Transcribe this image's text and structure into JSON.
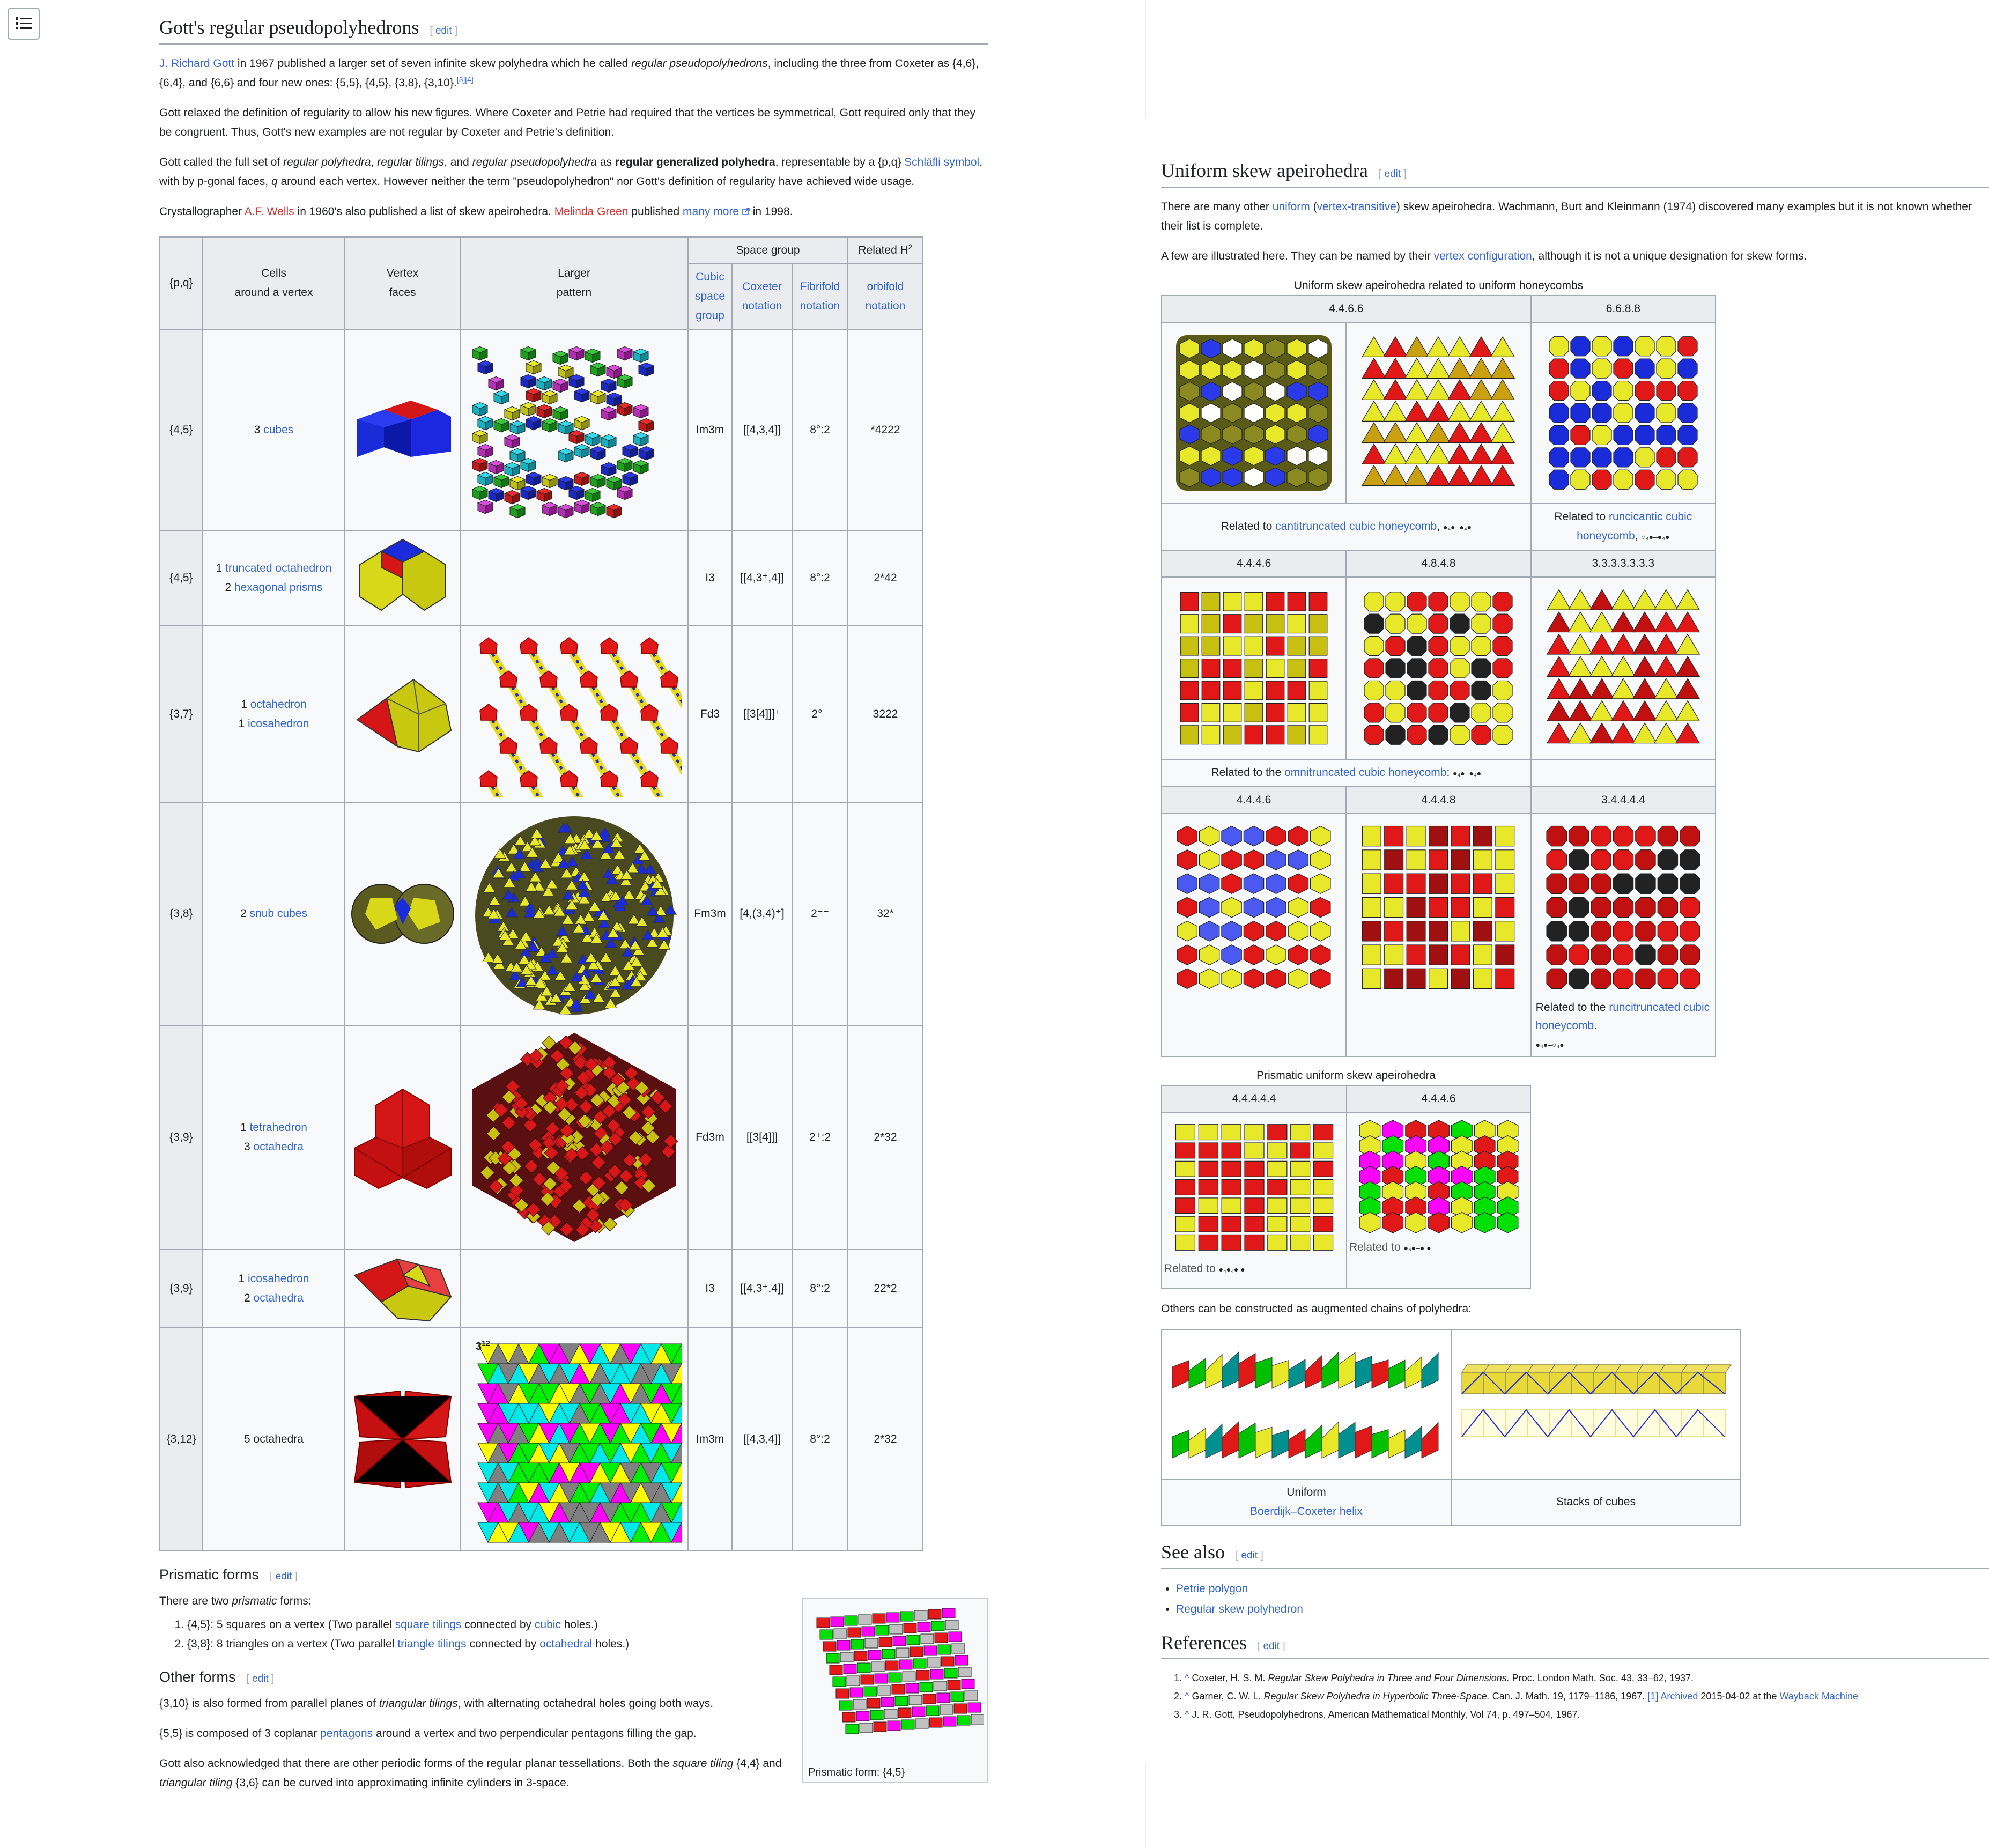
{
  "menu_icon": "list-icon",
  "gott": {
    "title": "Gott's regular pseudopolyhedrons",
    "edit": "edit",
    "p1": {
      "a1": "J. Richard Gott",
      "t1": " in 1967 published a larger set of seven infinite skew polyhedra which he called ",
      "em1": "regular pseudopolyhedrons",
      "t2": ", including the three from Coxeter as {4,6}, {6,4}, and {6,6} and four new ones: {5,5}, {4,5}, {3,8}, {3,10}.",
      "sup": "[3][4]"
    },
    "p2": "Gott relaxed the definition of regularity to allow his new figures. Where Coxeter and Petrie had required that the vertices be symmetrical, Gott required only that they be congruent. Thus, Gott's new examples are not regular by Coxeter and Petrie's definition.",
    "p3": {
      "t1": "Gott called the full set of ",
      "em1": "regular polyhedra",
      "t2": ", ",
      "em2": "regular tilings",
      "t3": ", and ",
      "em3": "regular pseudopolyhedra",
      "t4": " as ",
      "b1": "regular generalized polyhedra",
      "t5": ", representable by a {p,q} ",
      "a1": "Schläfli symbol",
      "t6": ", with by p-gonal faces, ",
      "em4": "q",
      "t7": " around each vertex. However neither the term \"pseudopolyhedron\" nor Gott's definition of regularity have achieved wide usage."
    },
    "p4": {
      "t1": "Crystallographer ",
      "a1": "A.F. Wells",
      "t2": " in 1960's also published a list of skew apeirohedra. ",
      "a2": "Melinda Green",
      "t3": " published ",
      "a3": "many more",
      "t4": " in 1998."
    }
  },
  "table": {
    "h_pq": "{p,q}",
    "h_cells1": "Cells",
    "h_cells2": "around a vertex",
    "h_vf1": "Vertex",
    "h_vf2": "faces",
    "h_lp1": "Larger",
    "h_lp2": "pattern",
    "h_space": "Space group",
    "h_rel": "Related H",
    "h_rel_sup": "2",
    "h_cubic": "Cubic space group",
    "h_cox": "Coxeter notation",
    "h_fib": "Fibrifold notation",
    "h_orb": "orbifold notation",
    "rows": [
      {
        "pq": "{4,5}",
        "c1n": "3 ",
        "c1l": "cubes",
        "c2n": "",
        "c2l": "",
        "sg": "Im3m",
        "cox": "[[4,3,4]]",
        "fib": "8°:2",
        "orb": "*4222"
      },
      {
        "pq": "{4,5}",
        "c1n": "1 ",
        "c1l": "truncated octahedron",
        "c2n": "2 ",
        "c2l": "hexagonal prisms",
        "sg": "I3",
        "cox": "[[4,3⁺,4]]",
        "fib": "8°:2",
        "orb": "2*42"
      },
      {
        "pq": "{3,7}",
        "c1n": "1 ",
        "c1l": "octahedron",
        "c2n": "1 ",
        "c2l": "icosahedron",
        "sg": "Fd3",
        "cox": "[[3[4]]]⁺",
        "fib": "2°⁻",
        "orb": "3222"
      },
      {
        "pq": "{3,8}",
        "c1n": "2 ",
        "c1l": "snub cubes",
        "c2n": "",
        "c2l": "",
        "sg": "Fm3m",
        "cox": "[4,(3,4)⁺]",
        "fib": "2⁻⁻",
        "orb": "32*"
      },
      {
        "pq": "{3,9}",
        "c1n": "1 ",
        "c1l": "tetrahedron",
        "c2n": "3 ",
        "c2l": "octahedra",
        "sg": "Fd3m",
        "cox": "[[3[4]]]",
        "fib": "2⁺:2",
        "orb": "2*32"
      },
      {
        "pq": "{3,9}",
        "c1n": "1 ",
        "c1l": "icosahedron",
        "c2n": "2 ",
        "c2l": "octahedra",
        "sg": "I3",
        "cox": "[[4,3⁺,4]]",
        "fib": "8°:2",
        "orb": "22*2"
      },
      {
        "pq": "{3,12}",
        "c1n": "5 octahedra",
        "c1l": "",
        "c2n": "",
        "c2l": "",
        "sg": "Im3m",
        "cox": "[[4,3,4]]",
        "fib": "8°:2",
        "orb": "2*32"
      }
    ],
    "lp_label_base": "3",
    "lp_label_sup": "12"
  },
  "prismatic": {
    "title": "Prismatic forms",
    "edit": "edit",
    "intro_t1": "There are two ",
    "intro_em": "prismatic",
    "intro_t2": " forms:",
    "li1": {
      "t1": "{4,5}: 5 squares on a vertex (Two parallel ",
      "a1": "square tilings",
      "t2": " connected by ",
      "a2": "cubic",
      "t3": " holes.)"
    },
    "li2": {
      "t1": "{3,8}: 8 triangles on a vertex (Two parallel ",
      "a1": "triangle tilings",
      "t2": " connected by ",
      "a2": "octahedral",
      "t3": " holes.)"
    },
    "thumb_cap": "Prismatic form: {4,5}"
  },
  "other": {
    "title": "Other forms",
    "edit": "edit",
    "p1": {
      "t1": "{3,10} is also formed from parallel planes of ",
      "em1": "triangular tilings",
      "t2": ", with alternating octahedral holes going both ways."
    },
    "p2": {
      "t1": "{5,5} is composed of 3 coplanar ",
      "a1": "pentagons",
      "t2": " around a vertex and two perpendicular pentagons filling the gap."
    },
    "p3": {
      "t1": "Gott also acknowledged that there are other periodic forms of the regular planar tessellations. Both the ",
      "em1": "square tiling",
      "t2": " {4,4} and ",
      "em2": "triangular tiling",
      "t3": " {3,6} can be curved into approximating infinite cylinders in 3-space."
    }
  },
  "uniform": {
    "title": "Uniform skew apeirohedra",
    "edit": "edit",
    "p1": {
      "t1": "There are many other ",
      "a1": "uniform",
      "t2": " (",
      "a2": "vertex-transitive",
      "t3": ") skew apeirohedra. Wachmann, Burt and Kleinmann (1974) discovered many examples but it is not known whether their list is complete."
    },
    "p2": {
      "t1": "A few are illustrated here. They can be named by their ",
      "a1": "vertex configuration",
      "t2": ", although it is not a unique designation for skew forms."
    },
    "t1_title": "Uniform skew apeirohedra related to uniform honeycombs",
    "h_446_6": "4.4.6.6",
    "h_6688": "6.6.8.8",
    "cap_cantitrunc_t": "Related to ",
    "cap_cantitrunc_a": "cantitruncated cubic honeycomb",
    "cap_runcicantic_t": "Related to ",
    "cap_runcicantic_a": "runcicantic cubic honeycomb",
    "h_4446": "4.4.4.6",
    "h_4848": "4.8.4.8",
    "h_3333": "3.3.3.3.3.3.3",
    "cap_omni_t": "Related to the ",
    "cap_omni_a": "omnitruncated cubic honeycomb",
    "h_4446b": "4.4.4.6",
    "h_4448": "4.4.4.8",
    "h_34444": "3.4.4.4.4",
    "cap_runcitrunc_t": "Related to the ",
    "cap_runcitrunc_a": "runcitruncated cubic honeycomb",
    "t2_title": "Prismatic uniform skew apeirohedra",
    "h_44444": "4.4.4.4.4",
    "h_4446c": "4.4.4.6",
    "cap_rel": "Related to",
    "p3": "Others can be constructed as augmented chains of polyhedra:",
    "chain_uniform": "Uniform",
    "chain_bc": "Boerdijk–Coxeter helix",
    "chain_stacks": "Stacks of cubes"
  },
  "seealso": {
    "title": "See also",
    "edit": "edit",
    "items": [
      "Petrie polygon",
      "Regular skew polyhedron"
    ]
  },
  "refs": {
    "title": "References",
    "edit": "edit",
    "r1": {
      "t1": "Coxeter, H. S. M. ",
      "em": "Regular Skew Polyhedra in Three and Four Dimensions.",
      "t2": " Proc. London Math. Soc. 43, 33–62, 1937."
    },
    "r2": {
      "t1": "Garner, C. W. L. ",
      "em": "Regular Skew Polyhedra in Hyperbolic Three-Space.",
      "t2": " Can. J. Math. 19, 1179–1186, 1967. ",
      "a1": "[1]",
      "a2": "Archived",
      "t3": " 2015-04-02 at the ",
      "a3": "Wayback Machine"
    },
    "r3": "J. R. Gott, Pseudopolyhedrons, American Mathematical Monthly, Vol 74, p. 497–504, 1967."
  },
  "colors": {
    "link": "#3366cc",
    "redlink": "#d73333",
    "border": "#a2a9b1",
    "header_bg": "#eaecf0",
    "table_bg": "#f8f9fa"
  }
}
